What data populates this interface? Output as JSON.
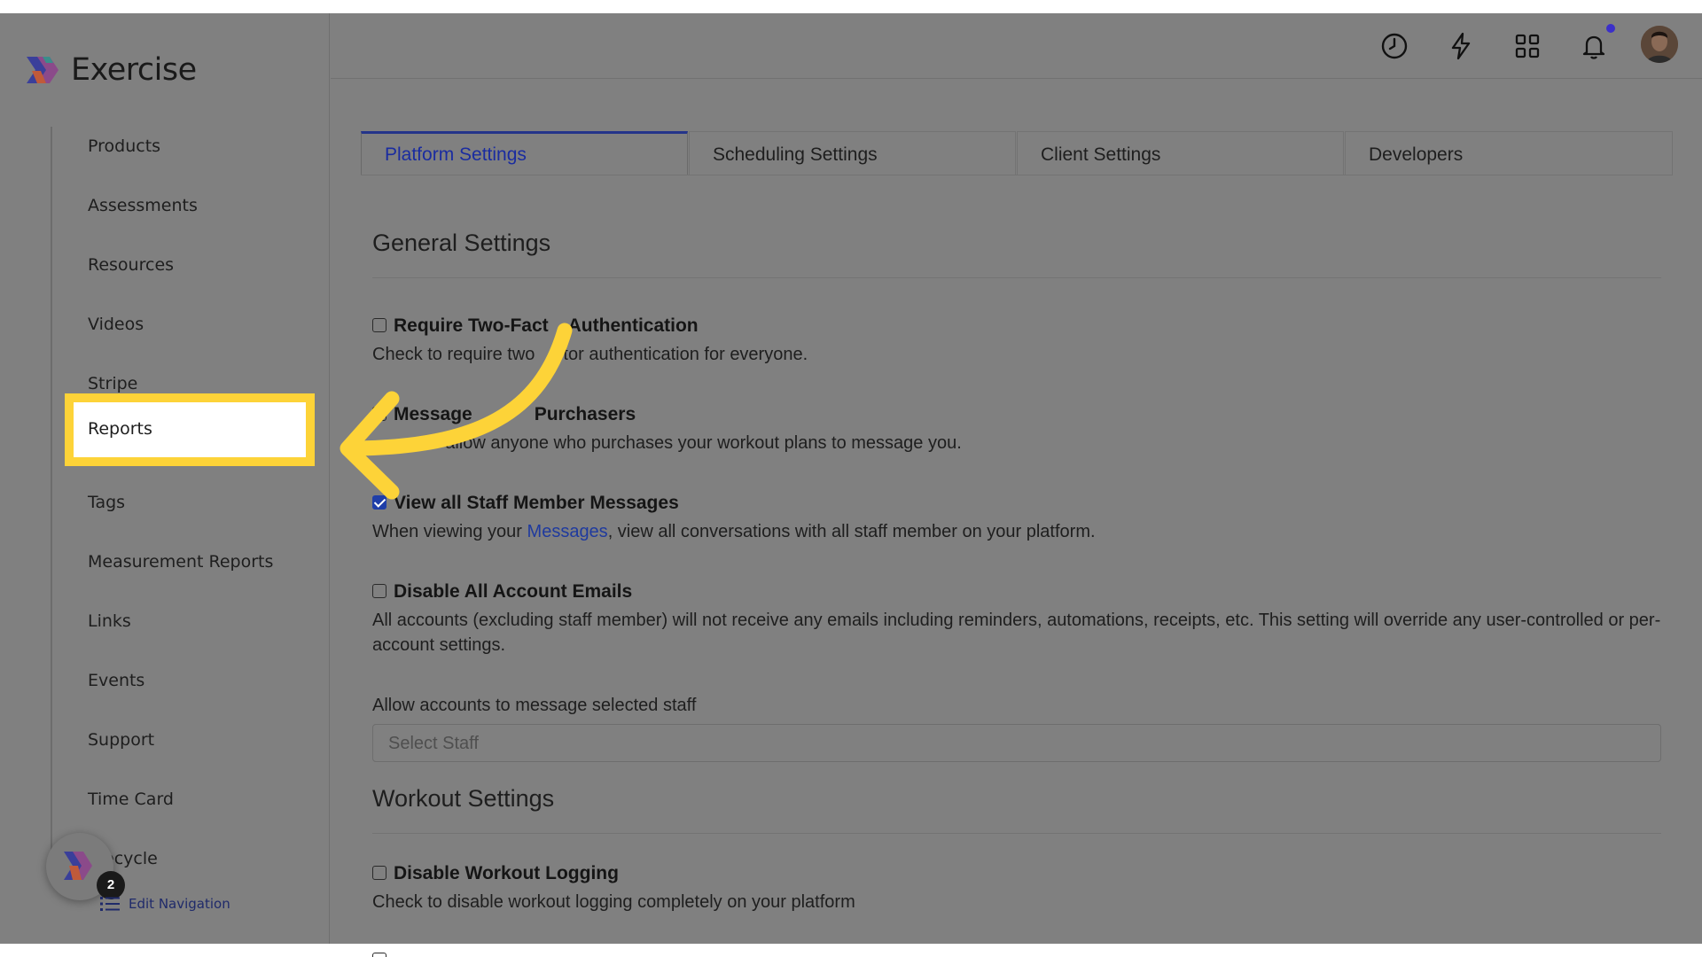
{
  "app": {
    "name": "Exercise"
  },
  "sidebar": {
    "items": [
      {
        "label": "Products",
        "top": 0
      },
      {
        "label": "Assessments"
      },
      {
        "label": "Resources"
      },
      {
        "label": "Videos"
      },
      {
        "label": "Stripe"
      },
      {
        "label": "Reports",
        "highlighted": true
      },
      {
        "label": "Tags"
      },
      {
        "label": "Measurement Reports"
      },
      {
        "label": "Links"
      },
      {
        "label": "Events"
      },
      {
        "label": "Support"
      },
      {
        "label": "Time Card"
      },
      {
        "label": "ecycle"
      }
    ],
    "help_badge_count": "2",
    "edit_navigation": "Edit Navigation"
  },
  "header": {
    "icons": [
      "clock-icon",
      "lightning-icon",
      "grid-icon",
      "bell-icon"
    ]
  },
  "tabs": [
    {
      "label": "Platform Settings",
      "active": true
    },
    {
      "label": "Scheduling Settings"
    },
    {
      "label": "Client Settings"
    },
    {
      "label": "Developers"
    }
  ],
  "general": {
    "title": "General Settings",
    "settings": [
      {
        "title": "Require Two-Fact",
        "title_tail": "Authentication",
        "desc": "Check to require two",
        "desc_tail": "ctor authentication for everyone.",
        "checked": false
      },
      {
        "title": "Message",
        "title_tail": "Purchasers",
        "desc_tail": "to allow anyone who purchases your workout plans to message you.",
        "checked": false
      },
      {
        "title": "View all Staff Member Messages",
        "desc_pre": "When viewing your ",
        "desc_link": "Messages",
        "desc_post": ", view all conversations with all staff member on your platform.",
        "checked": true
      },
      {
        "title": "Disable All Account Emails",
        "desc": "All accounts (excluding staff member) will not receive any emails including reminders, automations, receipts, etc. This setting will override any user-controlled or per-account settings.",
        "checked": false
      }
    ],
    "staff_field": {
      "label": "Allow accounts to message selected staff",
      "placeholder": "Select Staff"
    }
  },
  "workout": {
    "title": "Workout Settings",
    "settings": [
      {
        "title": "Disable Workout Logging",
        "desc": "Check to disable workout logging completely on your platform",
        "checked": false
      }
    ]
  },
  "colors": {
    "highlight": "#fdd338",
    "active_tab": "#1a2ca0",
    "link": "#1f3a9e",
    "overlay": "#808080"
  }
}
